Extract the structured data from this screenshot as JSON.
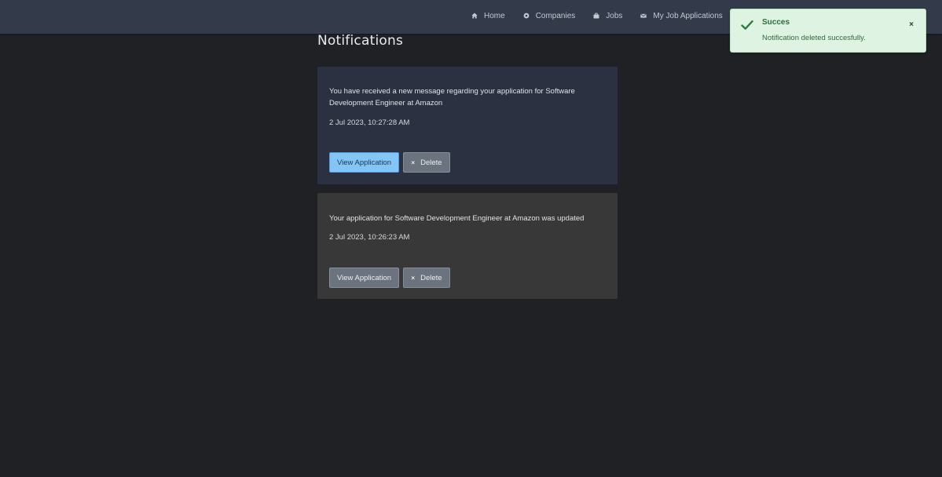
{
  "nav": {
    "items": [
      {
        "label": "Home",
        "icon": "home-icon"
      },
      {
        "label": "Companies",
        "icon": "companies-icon"
      },
      {
        "label": "Jobs",
        "icon": "briefcase-icon"
      },
      {
        "label": "My Job Applications",
        "icon": "envelope-icon"
      }
    ]
  },
  "page": {
    "title": "Notifications"
  },
  "notifications": [
    {
      "message": "You have received a new message regarding your application for Software Development Engineer at Amazon",
      "timestamp": "2 Jul 2023, 10:27:28 AM",
      "view_label": "View Application",
      "delete_icon": "×",
      "delete_label": "Delete",
      "state": "unread"
    },
    {
      "message": "Your application for Software Development Engineer at Amazon was updated",
      "timestamp": "2 Jul 2023, 10:26:23 AM",
      "view_label": "View Application",
      "delete_icon": "×",
      "delete_label": "Delete",
      "state": "read"
    }
  ],
  "toast": {
    "title": "Succes",
    "message": "Notification deleted succesfully.",
    "close": "×",
    "icon": "check-icon"
  },
  "colors": {
    "navbar": "#333b4a",
    "background": "#1f2125",
    "unread_card": "#2b3140",
    "read_card": "#383838",
    "primary_button": "#85c5f5",
    "toast_bg": "#dff3e3"
  }
}
